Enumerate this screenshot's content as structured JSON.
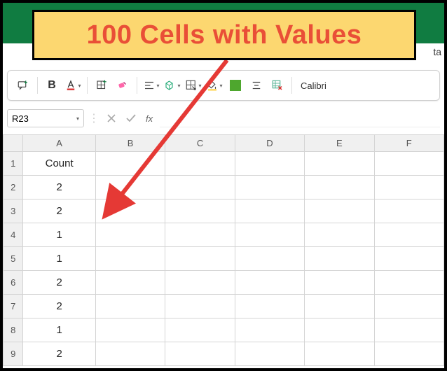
{
  "callout": {
    "text": "100 Cells with Values"
  },
  "ribbon_partial": "ta",
  "toolbar": {
    "bold": "B",
    "font_name": "Calibri"
  },
  "namebox": {
    "value": "R23"
  },
  "formula_bar": {
    "fx_label": "fx",
    "value": ""
  },
  "grid": {
    "columns": [
      "A",
      "B",
      "C",
      "D",
      "E",
      "F"
    ],
    "rows": [
      {
        "n": "1",
        "a": "Count"
      },
      {
        "n": "2",
        "a": "2"
      },
      {
        "n": "3",
        "a": "2"
      },
      {
        "n": "4",
        "a": "1"
      },
      {
        "n": "5",
        "a": "1"
      },
      {
        "n": "6",
        "a": "2"
      },
      {
        "n": "7",
        "a": "2"
      },
      {
        "n": "8",
        "a": "1"
      },
      {
        "n": "9",
        "a": "2"
      }
    ]
  },
  "chart_data": {
    "type": "table",
    "title": "Count",
    "categories": [
      "2",
      "3",
      "4",
      "5",
      "6",
      "7",
      "8",
      "9"
    ],
    "values": [
      2,
      2,
      1,
      1,
      2,
      2,
      1,
      2
    ]
  }
}
